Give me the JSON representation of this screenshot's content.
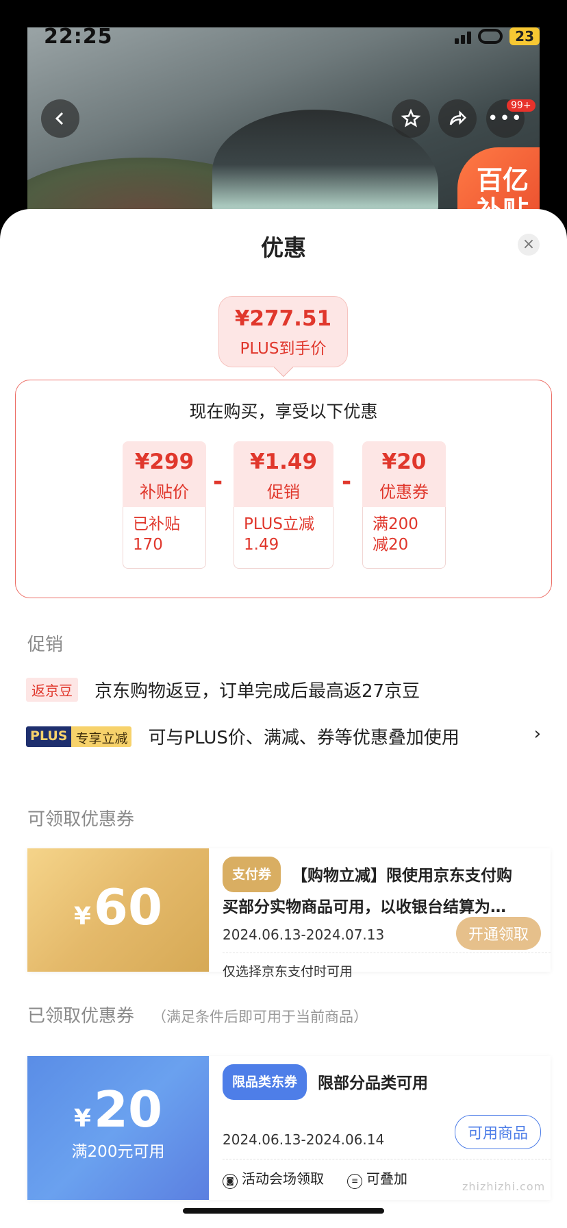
{
  "status_bar": {
    "time": "22:25",
    "battery": "23"
  },
  "banner": {
    "promo_line1": "百亿",
    "promo_line2": "补贴",
    "more_badge": "99+"
  },
  "sheet": {
    "title": "优惠",
    "close_symbol": "×"
  },
  "price_summary": {
    "price": "¥277.51",
    "label": "PLUS到手价"
  },
  "breakdown": {
    "title": "现在购买，享受以下优惠",
    "minus_symbol": "-",
    "items": [
      {
        "value": "¥299",
        "label": "补贴价",
        "detail_line1": "已补贴",
        "detail_line2": "170"
      },
      {
        "value": "¥1.49",
        "label": "促销",
        "detail_line1": "PLUS立减",
        "detail_line2": "1.49"
      },
      {
        "value": "¥20",
        "label": "优惠券",
        "detail_line1": "满200",
        "detail_line2": "减20"
      }
    ]
  },
  "promotions": {
    "section_title": "促销",
    "items": [
      {
        "tag": "返京豆",
        "text": "京东购物返豆，订单完成后最高返27京豆"
      },
      {
        "tag_a": "PLUS",
        "tag_b": "专享立减",
        "text": "可与PLUS价、满减、券等优惠叠加使用",
        "chevron": "›"
      }
    ]
  },
  "available_coupons": {
    "section_title": "可领取优惠券",
    "coupon": {
      "currency": "¥",
      "amount": "60",
      "tag": "支付券",
      "title_line1": "【购物立减】限使用京东支付购",
      "title_line2": "买部分实物商品可用，以收银台结算为…",
      "date": "2024.06.13-2024.07.13",
      "button": "开通领取",
      "note": "仅选择京东支付时可用"
    }
  },
  "claimed_coupons": {
    "section_title": "已领取优惠券",
    "section_hint": "（满足条件后即可用于当前商品）",
    "coupon": {
      "currency": "¥",
      "amount": "20",
      "condition": "满200元可用",
      "tag": "限品类东券",
      "title": "限部分品类可用",
      "date": "2024.06.13-2024.06.14",
      "button": "可用商品",
      "foot_1": "活动会场领取",
      "foot_2": "可叠加"
    }
  },
  "watermark": "zhizhizhi.com",
  "colors": {
    "accent_red": "#e0372c",
    "pill_bg": "#fde6e5",
    "gold": "#d9ae62",
    "blue": "#4e7ee8"
  }
}
